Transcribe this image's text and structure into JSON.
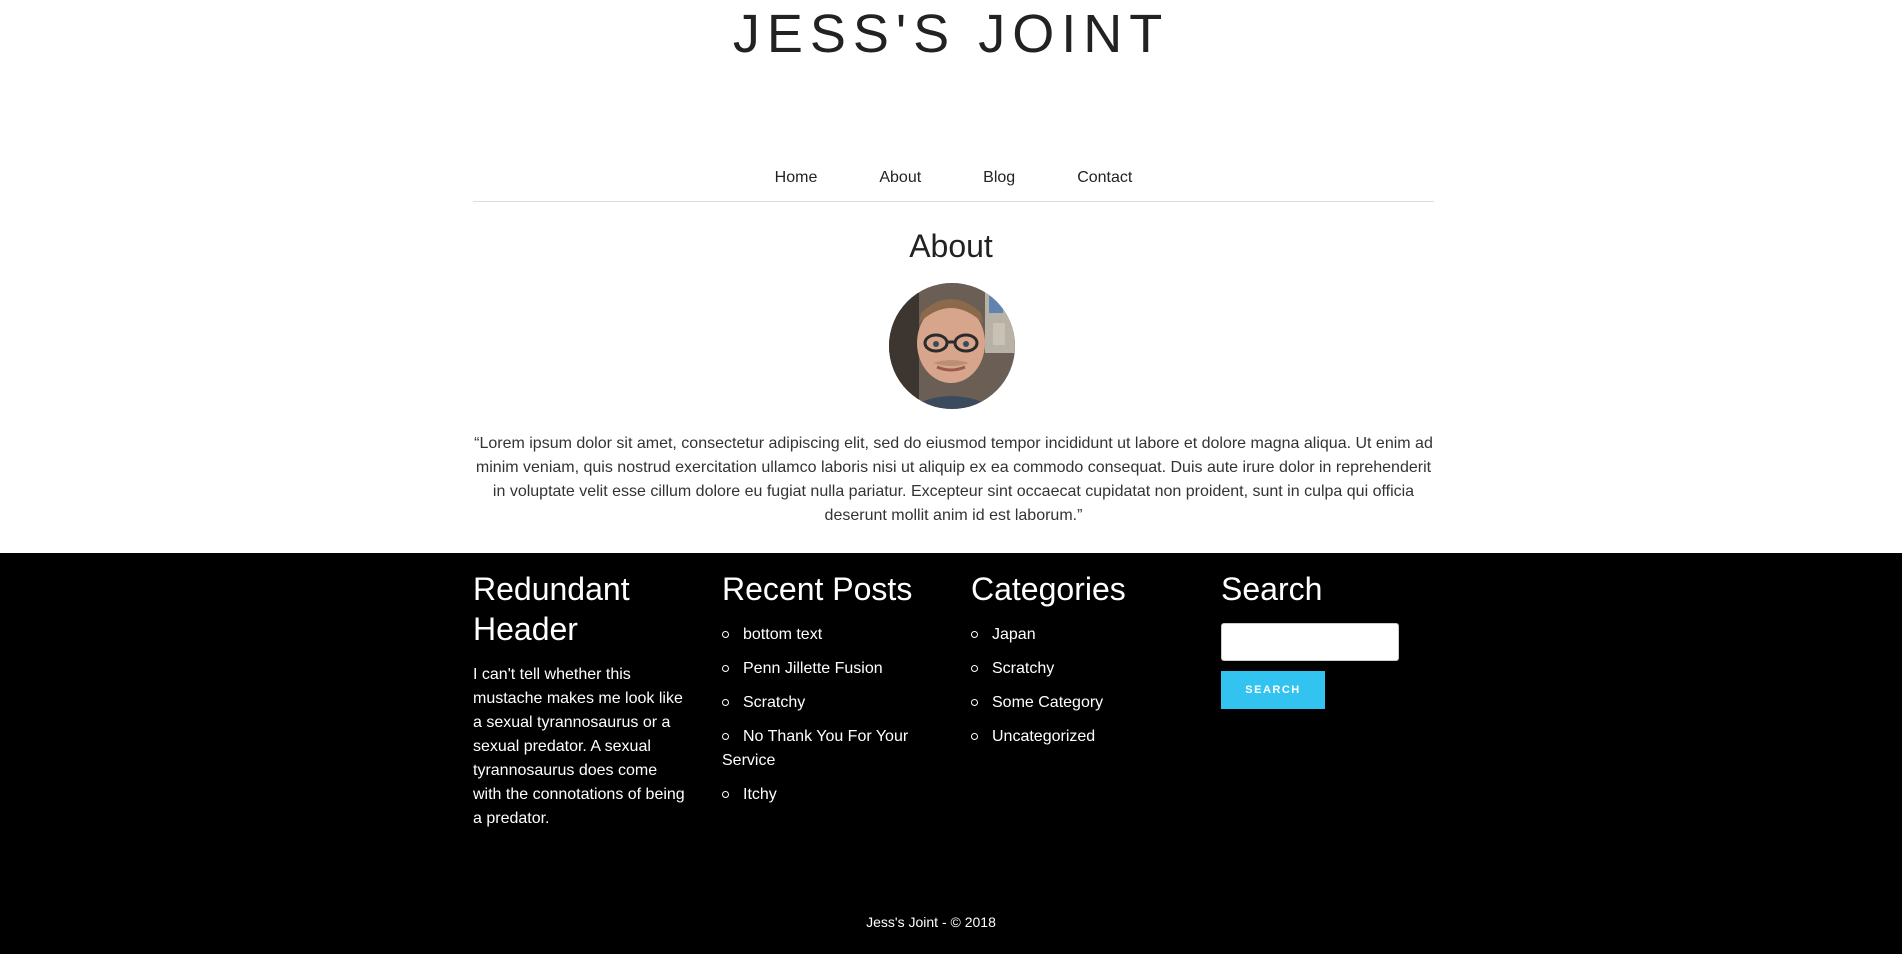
{
  "site": {
    "title": "JESS'S JOINT"
  },
  "nav": {
    "items": [
      {
        "label": "Home"
      },
      {
        "label": "About"
      },
      {
        "label": "Blog"
      },
      {
        "label": "Contact"
      }
    ]
  },
  "main": {
    "heading": "About",
    "avatar_icon": "profile-photo",
    "quote": "“Lorem ipsum dolor sit amet, consectetur adipiscing elit, sed do eiusmod tempor incididunt ut labore et dolore magna aliqua. Ut enim ad minim veniam, quis nostrud exercitation ullamco laboris nisi ut aliquip ex ea commodo consequat. Duis aute irure dolor in reprehenderit in voluptate velit esse cillum dolore eu fugiat nulla pariatur. Excepteur sint occaecat cupidatat non proident, sunt in culpa qui officia deserunt mollit anim id est laborum.”"
  },
  "footer": {
    "background_color": "#000000",
    "widgets": {
      "redundant": {
        "title": "Redundant Header",
        "body": "I can't tell whether this mustache makes me look like a sexual tyrannosaurus or a sexual predator. A sexual tyrannosaurus does come with the connotations of being a predator."
      },
      "recent_posts": {
        "title": "Recent Posts",
        "items": [
          "bottom text",
          "Penn Jillette Fusion",
          "Scratchy",
          "No Thank You For Your Service",
          "Itchy"
        ]
      },
      "categories": {
        "title": "Categories",
        "items": [
          "Japan",
          "Scratchy",
          "Some Category",
          "Uncategorized"
        ]
      },
      "search": {
        "title": "Search",
        "input_value": "",
        "button_label": "SEARCH",
        "button_color": "#33c3f0"
      }
    },
    "copyright": "Jess's Joint - © 2018"
  }
}
